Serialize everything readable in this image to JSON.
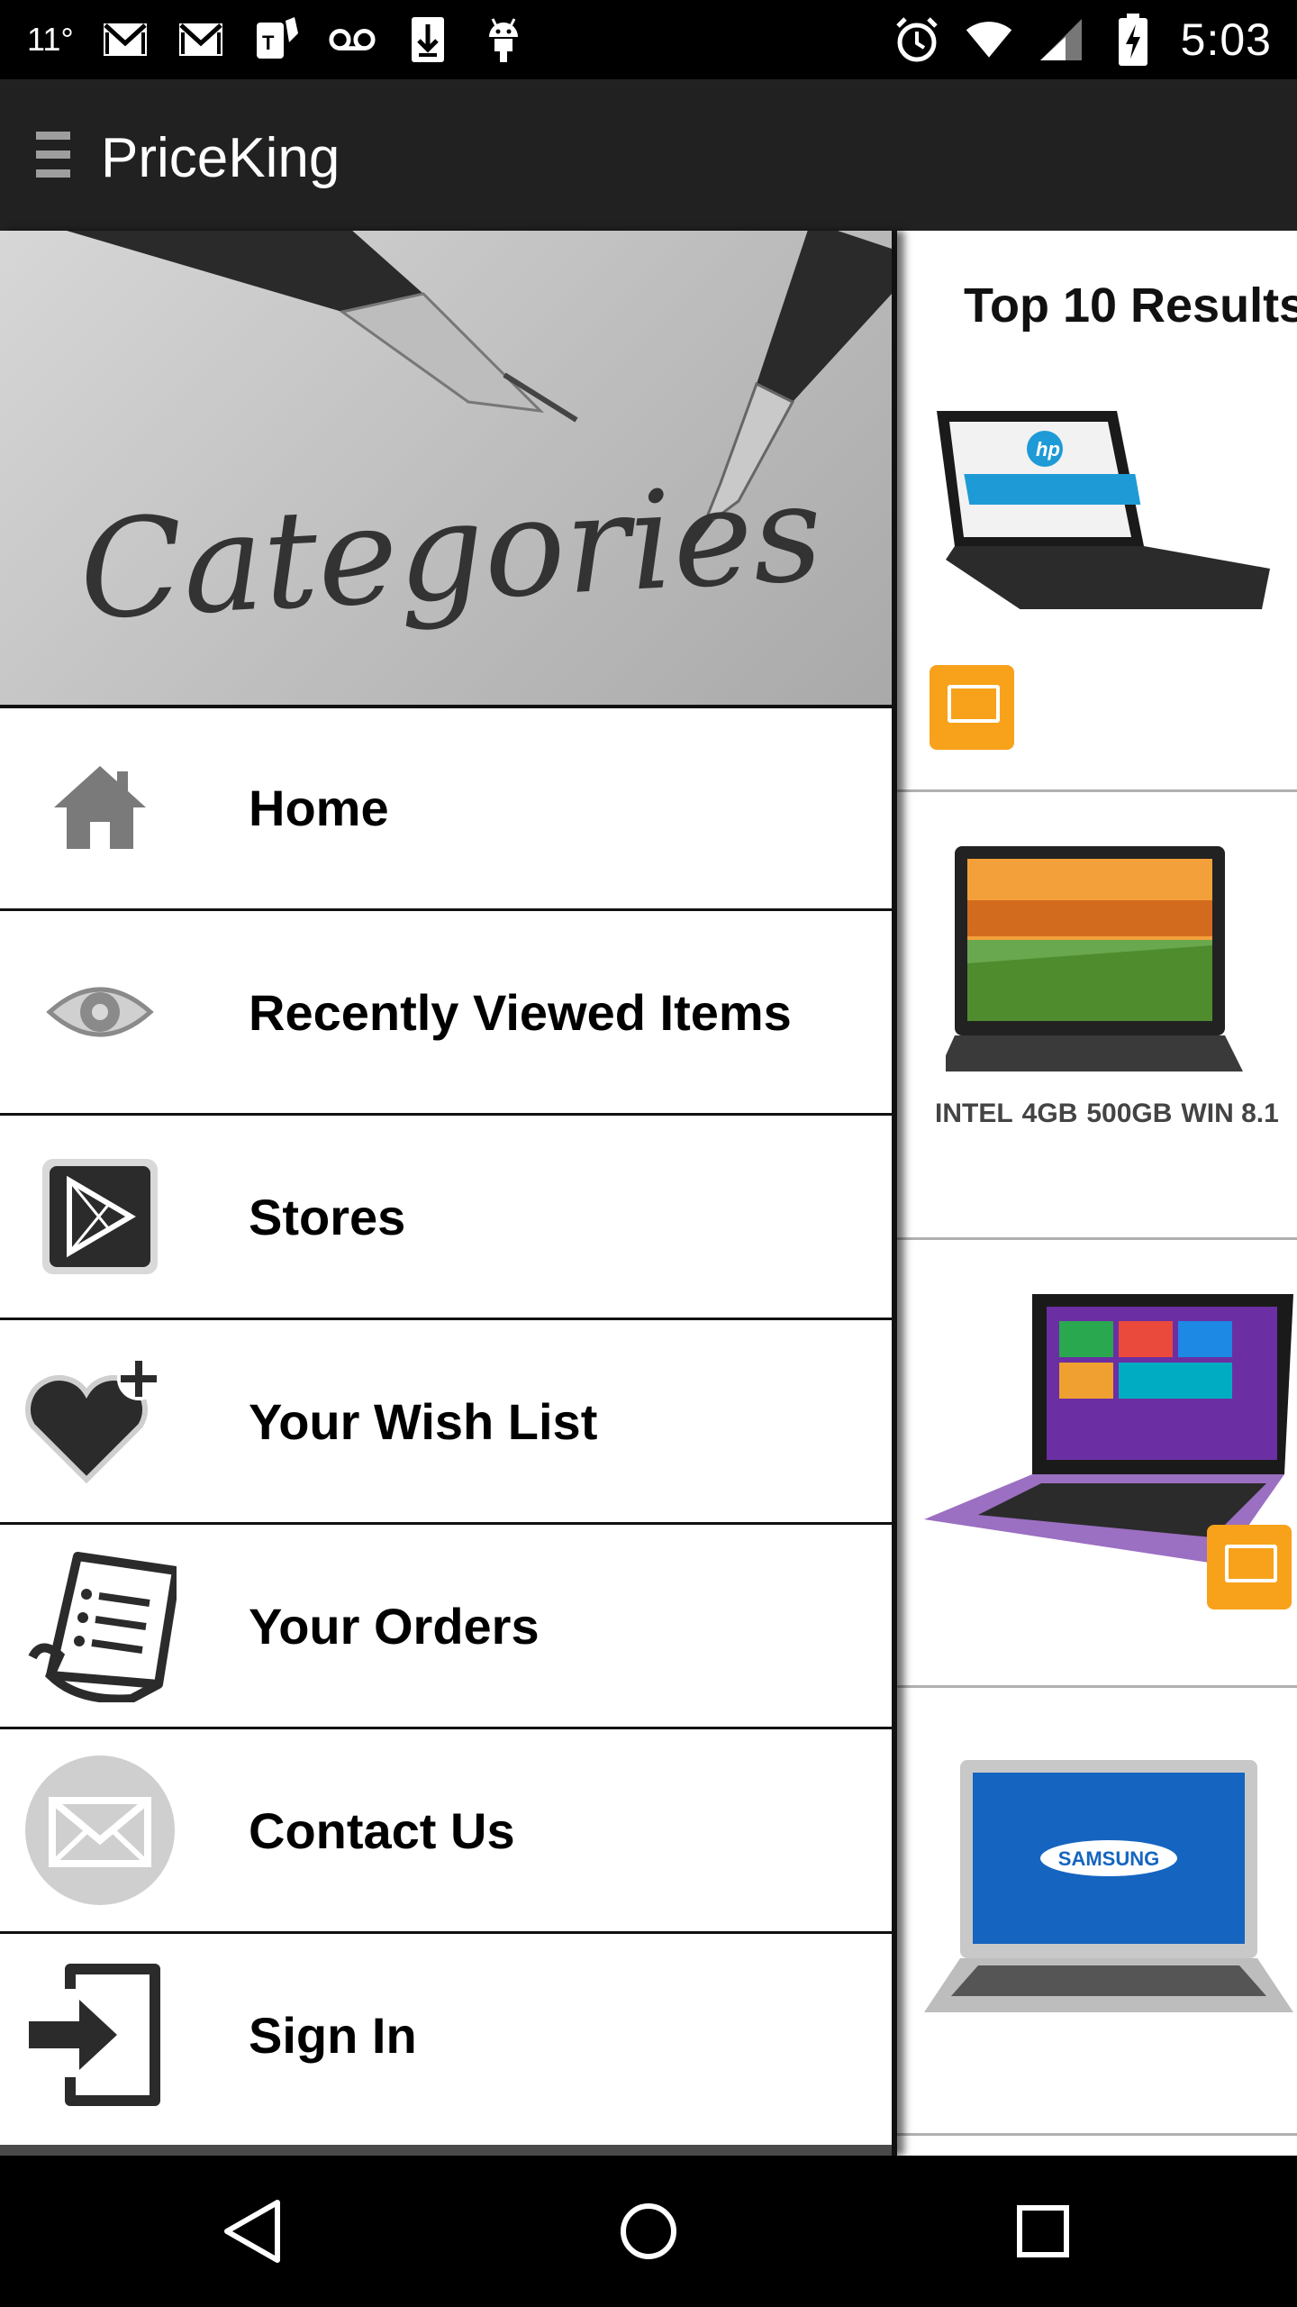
{
  "status_bar": {
    "temperature": "11°",
    "time": "5:03",
    "icons": [
      "gmail-icon",
      "gmail-icon",
      "tmobile-icon",
      "voicemail-icon",
      "download-icon",
      "android-icon",
      "alarm-icon",
      "wifi-icon",
      "signal-icon",
      "battery-charging-icon"
    ]
  },
  "app_bar": {
    "title": "PriceKing",
    "menu_icon": "hamburger-icon"
  },
  "drawer": {
    "header_title": "Categories",
    "items": [
      {
        "label": "Home",
        "icon": "home-icon"
      },
      {
        "label": "Recently Viewed Items",
        "icon": "eye-icon"
      },
      {
        "label": "Stores",
        "icon": "play-store-icon"
      },
      {
        "label": "Your Wish List",
        "icon": "heart-plus-icon"
      },
      {
        "label": "Your Orders",
        "icon": "receipt-icon"
      },
      {
        "label": "Contact Us",
        "icon": "envelope-icon"
      },
      {
        "label": "Sign In",
        "icon": "sign-in-icon"
      }
    ]
  },
  "content": {
    "results_title": "Top 10 Results",
    "products": [
      {
        "brand_text": "hp"
      },
      {
        "specs": [
          "INTEL",
          "4GB",
          "500GB",
          "WIN 8.1"
        ]
      },
      {
        "brand_text": ""
      },
      {
        "brand_text": "SAMSUNG"
      }
    ]
  },
  "nav_bar": {
    "buttons": [
      "back-icon",
      "home-circle-icon",
      "recents-icon"
    ]
  },
  "colors": {
    "app_bar": "#212121",
    "status_bar": "#000000",
    "accent_badge": "#f7a21a"
  }
}
